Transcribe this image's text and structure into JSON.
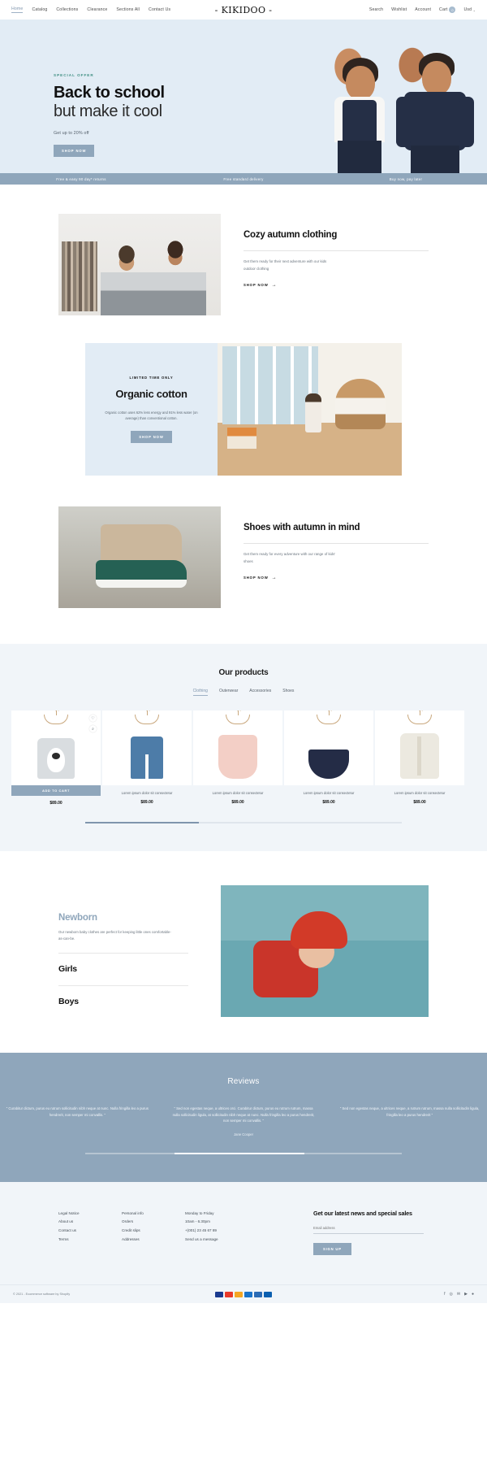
{
  "header": {
    "logo": "- KIKIDOO -",
    "nav": [
      {
        "label": "Home",
        "active": true
      },
      {
        "label": "Catalog",
        "active": false
      },
      {
        "label": "Collections",
        "active": false
      },
      {
        "label": "Clearance",
        "active": false
      },
      {
        "label": "Sections All",
        "active": false
      },
      {
        "label": "Contact Us",
        "active": false
      }
    ],
    "utility": {
      "search": "Search",
      "wishlist": "Wishlist",
      "account": "Account",
      "cart": "Cart",
      "cart_count": "0",
      "currency": "Usd",
      "currency_caret": "⌄"
    }
  },
  "hero": {
    "eyebrow": "SPECIAL OFFER",
    "title_bold": "Back to school",
    "title_light": "but make it cool",
    "subtitle": "Get up to 20% off",
    "cta": "SHOP NOW"
  },
  "benefits": [
    {
      "label": "Free & easy 90 day* returns"
    },
    {
      "label": "Free standard delivery"
    },
    {
      "label": "Buy now, pay later"
    }
  ],
  "features": [
    {
      "title": "Cozy autumn clothing",
      "desc": "Get them ready for their next adventure with our kids outdoor clothing",
      "cta": "SHOP NOW",
      "arrow": "→"
    },
    {
      "title": "Shoes with autumn in mind",
      "desc": "Get them ready for every adventure with our range of kids' shoes",
      "cta": "SHOP NOW",
      "arrow": "→"
    }
  ],
  "organic": {
    "eyebrow": "LIMITED TIME ONLY",
    "title": "Organic cotton",
    "desc": "Organic cotton uses 62% less energy and 91% less water (on average) than conventional cotton.",
    "cta": "SHOP NOW"
  },
  "products": {
    "title": "Our products",
    "tabs": [
      {
        "label": "Clothing",
        "active": true
      },
      {
        "label": "Outerwear",
        "active": false
      },
      {
        "label": "Accessories",
        "active": false
      },
      {
        "label": "Shoes",
        "active": false
      }
    ],
    "items": [
      {
        "name": "",
        "price": "$89.00",
        "add_to_cart": "ADD TO CART",
        "wishlist_icon": "♡",
        "quickview_icon": "⌕"
      },
      {
        "name": "Lorem ipsum dolor sit consectetur",
        "price": "$89.00"
      },
      {
        "name": "Lorem ipsum dolor sit consectetur",
        "price": "$89.00"
      },
      {
        "name": "Lorem ipsum dolor sit consectetur",
        "price": "$89.00"
      },
      {
        "name": "Lorem ipsum dolor sit consectetur",
        "price": "$89.00"
      }
    ]
  },
  "newborn": {
    "kicker": "Newborn",
    "desc": "Our newborn baby clothes are perfect for keeping little ones comfortable-as-can-be.",
    "link_girls": "Girls",
    "link_boys": "Boys"
  },
  "reviews": {
    "title": "Reviews",
    "items": [
      {
        "text": "” Curabitur dictum, purus eu rutrum sollicitudin nibh neque at nunc. Nulla fringilla leo a purus hendrerit, non semper mi convallis. ”",
        "author": ""
      },
      {
        "text": "” Sed non egestas neque, a ultrices orci. Curabitur dictum, purus eu rutrum rutrum, massa nulla sollicitudin ligula, at sollicitudin nibh neque at nunc. Nulla fringilla leo a purus hendrerit, non semper mi convallis. ”",
        "author": "Jane Cooper"
      },
      {
        "text": "” Sed non egestas neque, a ultrices neque, a rutrum rutrum, massa nulla sollicitudin ligula, fringilla leo a purus hendrerit ”",
        "author": ""
      }
    ]
  },
  "footer": {
    "col1": [
      "Legal Notice",
      "About us",
      "Contact us",
      "Terms"
    ],
    "col2": [
      "Personal info",
      "Orders",
      "Credit slips",
      "Addresses"
    ],
    "col3": [
      "Monday to Friday",
      "10am - 6.30pm",
      "+(001) 23 45 67 89",
      "Send us a message"
    ],
    "newsletter": {
      "title": "Get our latest news and special sales",
      "placeholder": "Email address",
      "button": "SIGN UP"
    },
    "copyright": "© 2021 - Ecommerce software by Shopify",
    "payments": [
      "#1a3a8f",
      "#e8392a",
      "#f5a623",
      "#1a73c9",
      "#2b6bb5",
      "#0b5fb0"
    ],
    "social": [
      "f",
      "◎",
      "✉",
      "▶",
      "●"
    ]
  }
}
